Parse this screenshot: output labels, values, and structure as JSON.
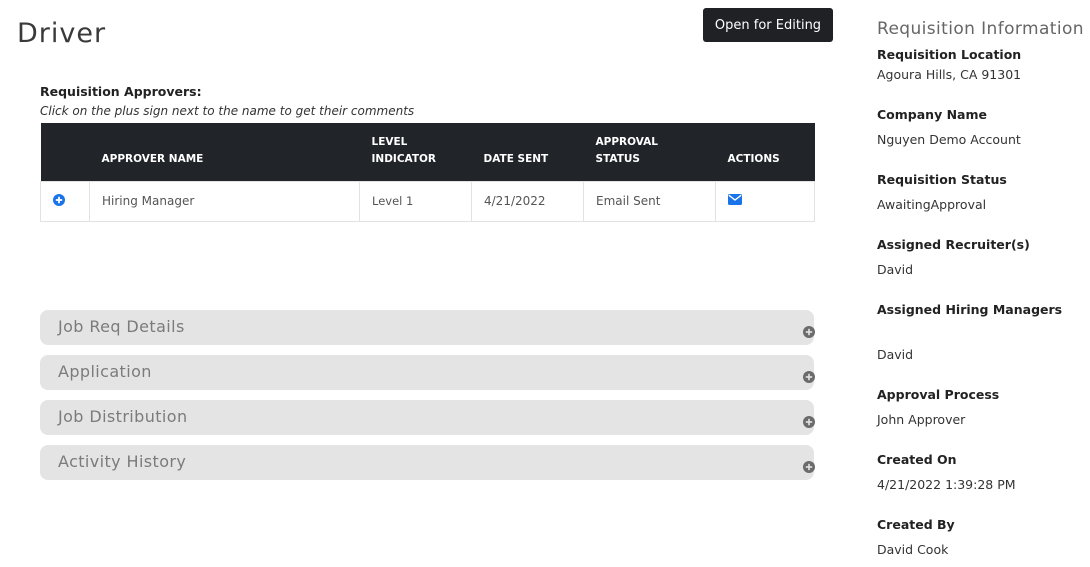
{
  "page": {
    "title": "Driver",
    "edit_button": "Open for Editing"
  },
  "approvers": {
    "title": "Requisition Approvers:",
    "hint": "Click on the plus sign next to the name to get their comments",
    "columns": [
      "",
      "APPROVER NAME",
      "LEVEL\nINDICATOR",
      "DATE SENT",
      "APPROVAL STATUS",
      "ACTIONS"
    ],
    "column_approver_name": "APPROVER NAME",
    "column_level_line1": "LEVEL",
    "column_level_line2": "INDICATOR",
    "column_date_sent": "DATE SENT",
    "column_approval_status": "APPROVAL STATUS",
    "column_actions": "ACTIONS",
    "rows": [
      {
        "approver_name": "Hiring Manager",
        "level": "Level 1",
        "date_sent": "4/21/2022",
        "status": "Email Sent",
        "expand_icon": "plus-circle-icon",
        "action_icon": "envelope-icon"
      }
    ]
  },
  "sections": [
    {
      "label": "Job Req Details",
      "icon": "plus-circle-icon"
    },
    {
      "label": "Application",
      "icon": "plus-circle-icon"
    },
    {
      "label": "Job Distribution",
      "icon": "plus-circle-icon"
    },
    {
      "label": "Activity History",
      "icon": "plus-circle-icon"
    }
  ],
  "requisition_info": {
    "heading": "Requisition Information",
    "fields": [
      {
        "label": "Requisition Location",
        "value": "Agoura Hills, CA 91301"
      },
      {
        "label": "Company Name",
        "value": "Nguyen Demo Account"
      },
      {
        "label": "Requisition Status",
        "value": "AwaitingApproval"
      },
      {
        "label": "Assigned Recruiter(s)",
        "value": "David"
      },
      {
        "label": "Assigned Hiring Managers",
        "value": "David"
      },
      {
        "label": "Approval Process",
        "value": "John Approver"
      },
      {
        "label": "Created On",
        "value": "4/21/2022 1:39:28 PM"
      },
      {
        "label": "Created By",
        "value": "David Cook"
      }
    ]
  },
  "colors": {
    "table_header_bg": "#212529",
    "button_bg": "#1f2125",
    "accordion_bg": "#e4e4e4",
    "icon_blue": "#1a73e8"
  }
}
